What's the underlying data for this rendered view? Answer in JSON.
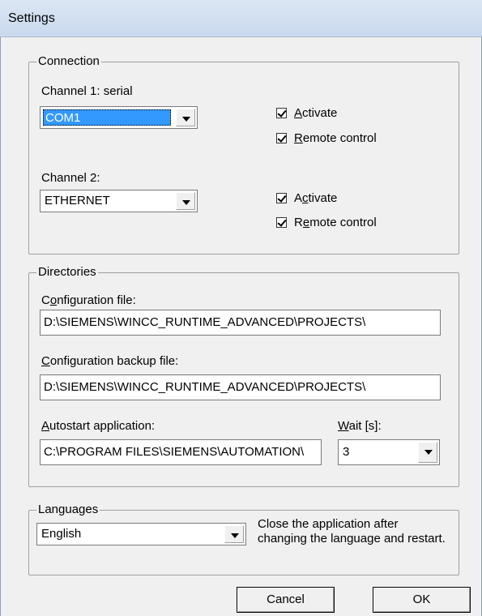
{
  "window": {
    "title": "Settings"
  },
  "connection": {
    "group_label": "Connection",
    "channel1": {
      "label": "Channel 1: serial",
      "selected": "COM1",
      "activate_label": "Activate",
      "remote_label": "Remote control",
      "activate_checked": true,
      "remote_checked": true
    },
    "channel2": {
      "label": "Channel 2:",
      "selected": "ETHERNET",
      "activate_label": "Activate",
      "remote_label": "Remote control",
      "activate_checked": true,
      "remote_checked": true
    }
  },
  "directories": {
    "group_label": "Directories",
    "config_label": "Configuration file:",
    "config_value": "D:\\SIEMENS\\WINCC_RUNTIME_ADVANCED\\PROJECTS\\",
    "backup_label": "Configuration backup file:",
    "backup_value": "D:\\SIEMENS\\WINCC_RUNTIME_ADVANCED\\PROJECTS\\",
    "autostart_label": "Autostart application:",
    "autostart_value": "C:\\PROGRAM FILES\\SIEMENS\\AUTOMATION\\",
    "wait_label": "Wait [s]:",
    "wait_value": "3"
  },
  "languages": {
    "group_label": "Languages",
    "selected": "English",
    "note": "Close the application after changing the language and restart."
  },
  "buttons": {
    "cancel": "Cancel",
    "ok": "OK"
  }
}
